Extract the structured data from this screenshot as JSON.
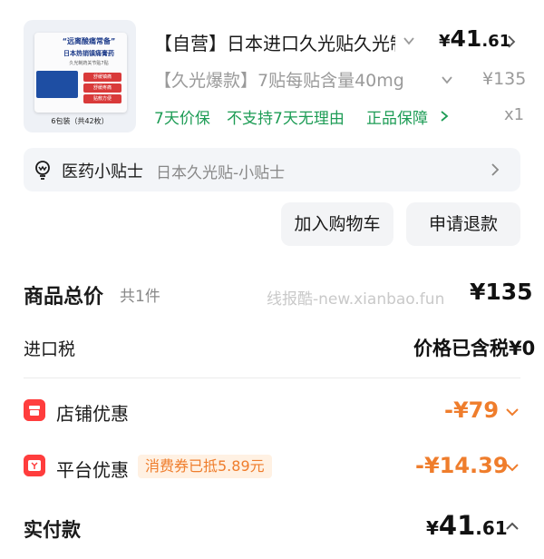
{
  "product": {
    "thumbnail": {
      "slogan": "“远离酸痛常备”",
      "subtitle": "日本热销镇痛膏药",
      "subtitle2": "久光制药关节贴7贴",
      "tags": [
        "舒缓镇痛",
        "舒缓疼痛",
        "贴敷方便"
      ],
      "caption": "6包装（共42枚）"
    },
    "title": "【自营】日本进口久光贴久光制药",
    "price_currency": "¥",
    "price_int": "41",
    "price_dec": ".61",
    "spec": "【久光爆款】7贴每贴含量40mg",
    "original_price": "¥135",
    "services": [
      "7天价保",
      "不支持7天无理由",
      "正品保障"
    ],
    "quantity": "x1"
  },
  "tips": {
    "icon": "lightbulb-icon",
    "label": "医药小贴士",
    "text": "日本久光贴-小贴士"
  },
  "actions": {
    "add_to_cart": "加入购物车",
    "refund": "申请退款"
  },
  "summary": {
    "total_label": "商品总价",
    "total_count": "共1件",
    "watermark": "线报酷-new.xianbao.fun",
    "total_price": "¥135",
    "tax_label": "进口税",
    "tax_value": "价格已含税¥0",
    "store_discount_label": "店铺优惠",
    "store_discount_value": "-¥79",
    "platform_discount_label": "平台优惠",
    "platform_coupon_badge": "消费券已抵5.89元",
    "platform_discount_value": "-¥14.39",
    "paid_label": "实付款",
    "paid_currency": "¥",
    "paid_int": "41",
    "paid_dec": ".61"
  },
  "colors": {
    "accent_green": "#1d9c55",
    "discount_orange": "#ef7d2c",
    "icon_red": "#ff3d3d"
  }
}
